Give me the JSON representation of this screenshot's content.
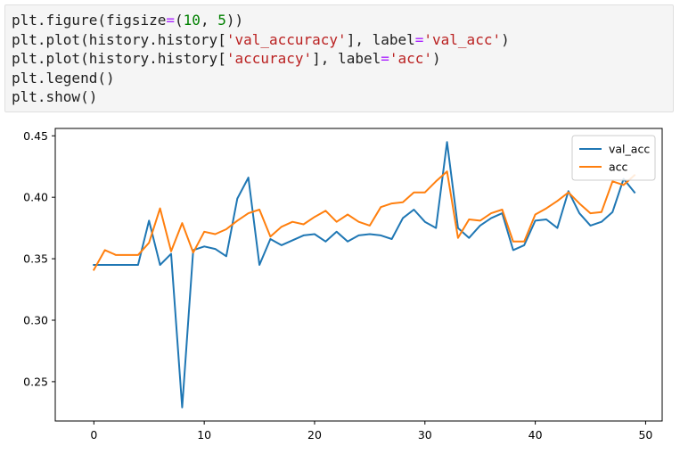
{
  "code_cell": {
    "lines": [
      [
        {
          "text": "plt.figure(figsize",
          "kind": "plain"
        },
        {
          "text": "=",
          "kind": "op"
        },
        {
          "text": "(",
          "kind": "plain"
        },
        {
          "text": "10",
          "kind": "num"
        },
        {
          "text": ", ",
          "kind": "plain"
        },
        {
          "text": "5",
          "kind": "num"
        },
        {
          "text": "))",
          "kind": "plain"
        }
      ],
      [
        {
          "text": "plt.plot(history.history[",
          "kind": "plain"
        },
        {
          "text": "'val_accuracy'",
          "kind": "str"
        },
        {
          "text": "], label",
          "kind": "plain"
        },
        {
          "text": "=",
          "kind": "op"
        },
        {
          "text": "'val_acc'",
          "kind": "str"
        },
        {
          "text": ")",
          "kind": "plain"
        }
      ],
      [
        {
          "text": "plt.plot(history.history[",
          "kind": "plain"
        },
        {
          "text": "'accuracy'",
          "kind": "str"
        },
        {
          "text": "], label",
          "kind": "plain"
        },
        {
          "text": "=",
          "kind": "op"
        },
        {
          "text": "'acc'",
          "kind": "str"
        },
        {
          "text": ")",
          "kind": "plain"
        }
      ],
      [
        {
          "text": "plt.legend()",
          "kind": "plain"
        }
      ],
      [
        {
          "text": "plt.show()",
          "kind": "plain"
        }
      ]
    ]
  },
  "chart_data": {
    "type": "line",
    "title": "",
    "xlabel": "",
    "ylabel": "",
    "xlim": [
      -3.5,
      51.5
    ],
    "ylim": [
      0.218,
      0.456
    ],
    "xticks": [
      0,
      10,
      20,
      30,
      40,
      50
    ],
    "yticks": [
      0.25,
      0.3,
      0.35,
      0.4,
      0.45
    ],
    "ytick_labels": [
      "0.25",
      "0.30",
      "0.35",
      "0.40",
      "0.45"
    ],
    "grid": false,
    "legend_position": "top-right",
    "x": [
      0,
      1,
      2,
      3,
      4,
      5,
      6,
      7,
      8,
      9,
      10,
      11,
      12,
      13,
      14,
      15,
      16,
      17,
      18,
      19,
      20,
      21,
      22,
      23,
      24,
      25,
      26,
      27,
      28,
      29,
      30,
      31,
      32,
      33,
      34,
      35,
      36,
      37,
      38,
      39,
      40,
      41,
      42,
      43,
      44,
      45,
      46,
      47,
      48,
      49
    ],
    "series": [
      {
        "name": "val_acc",
        "color": "#1f77b4",
        "values": [
          0.345,
          0.345,
          0.345,
          0.345,
          0.345,
          0.381,
          0.345,
          0.354,
          0.229,
          0.357,
          0.36,
          0.358,
          0.352,
          0.399,
          0.416,
          0.345,
          0.366,
          0.361,
          0.365,
          0.369,
          0.37,
          0.364,
          0.372,
          0.364,
          0.369,
          0.37,
          0.369,
          0.366,
          0.383,
          0.39,
          0.38,
          0.375,
          0.445,
          0.375,
          0.367,
          0.377,
          0.383,
          0.387,
          0.357,
          0.361,
          0.381,
          0.382,
          0.375,
          0.405,
          0.387,
          0.377,
          0.38,
          0.388,
          0.415,
          0.404
        ]
      },
      {
        "name": "acc",
        "color": "#ff7f0e",
        "values": [
          0.341,
          0.357,
          0.353,
          0.353,
          0.353,
          0.363,
          0.391,
          0.356,
          0.379,
          0.355,
          0.372,
          0.37,
          0.374,
          0.381,
          0.387,
          0.39,
          0.368,
          0.376,
          0.38,
          0.378,
          0.384,
          0.389,
          0.38,
          0.386,
          0.38,
          0.377,
          0.392,
          0.395,
          0.396,
          0.404,
          0.404,
          0.413,
          0.421,
          0.367,
          0.382,
          0.381,
          0.387,
          0.39,
          0.364,
          0.364,
          0.386,
          0.391,
          0.397,
          0.404,
          0.395,
          0.387,
          0.388,
          0.413,
          0.41,
          0.418
        ]
      }
    ]
  }
}
